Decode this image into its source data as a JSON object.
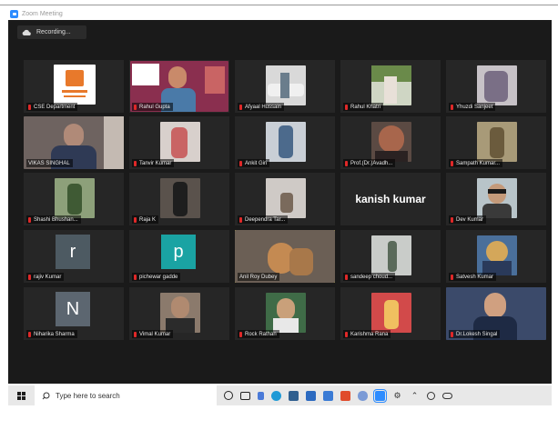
{
  "window": {
    "title": "Zoom Meeting"
  },
  "recording": {
    "label": "Recording..."
  },
  "participants": [
    {
      "name": "CSE Department",
      "bg": "#ffffff",
      "accent": "#e8792b"
    },
    {
      "name": "Rahul Gupta",
      "bg": "#8a2f4f",
      "accent": "#c98a6a"
    },
    {
      "name": "Afyaal Hussain",
      "bg": "#d9d9d9",
      "accent": "#6a7d8c"
    },
    {
      "name": "Rahul Khatri",
      "bg": "#cfd6c4",
      "accent": "#6a8a4a"
    },
    {
      "name": "Yhuzdi Sanjeet",
      "bg": "#c7c2c7",
      "accent": "#7a6f86"
    },
    {
      "name": "VIKAS SINGHAL",
      "bg": "#6e6360",
      "accent": "#3b3a40"
    },
    {
      "name": "Tanvir Kumar",
      "bg": "#d8d0cc",
      "accent": "#c96464"
    },
    {
      "name": "Ankit Giri",
      "bg": "#c9cfd6",
      "accent": "#4c6a8c"
    },
    {
      "name": "Prof.(Dr.)Avadh...",
      "bg": "#5b4a43",
      "accent": "#2a2222"
    },
    {
      "name": "Sampath Kumar...",
      "bg": "#a89a78",
      "accent": "#6b5b3d"
    },
    {
      "name": "Shashi Bhushan...",
      "bg": "#8da07a",
      "accent": "#3f5a34"
    },
    {
      "name": "Raja K",
      "bg": "#5a524c",
      "accent": "#1e1e1e"
    },
    {
      "name": "Deependra Tar...",
      "bg": "#cfcac6",
      "accent": "#7a6a5c"
    },
    {
      "name": "kanish kumar",
      "bg": "#262626",
      "accent": "#ffffff"
    },
    {
      "name": "Dev Kumar",
      "bg": "#b8c4c9",
      "accent": "#3a3a3a"
    },
    {
      "name": "rajiv Kumar",
      "bg": "#4d5a62",
      "accent": "#ffffff"
    },
    {
      "name": "pichewar gadde",
      "bg": "#1aa3a3",
      "accent": "#ffffff"
    },
    {
      "name": "Anil Roy Dubey",
      "bg": "#6b5f55",
      "accent": "#c48a52"
    },
    {
      "name": "sandeep choud...",
      "bg": "#c9ccc9",
      "accent": "#5a6a5a"
    },
    {
      "name": "Satvesh Kumar",
      "bg": "#4a6f9a",
      "accent": "#d4a75a"
    },
    {
      "name": "Niharika Sharma",
      "bg": "#5c6670",
      "accent": "#ffffff"
    },
    {
      "name": "Vimal Kumar",
      "bg": "#8b7a6c",
      "accent": "#2b2b2b"
    },
    {
      "name": "Rock Rathan",
      "bg": "#3f6b47",
      "accent": "#c9a07a"
    },
    {
      "name": "Karishma Rana",
      "bg": "#d24a4a",
      "accent": "#f0c060"
    },
    {
      "name": "Dr.Lokesh Singal",
      "bg": "#3b4a6a",
      "accent": "#d0a080"
    }
  ],
  "avatars": {
    "rajiv": "r",
    "pichewar": "p",
    "niharika": "N"
  },
  "taskbar": {
    "search_placeholder": "Type here to search"
  },
  "colors": {
    "meeting_bg": "#1a1a1a",
    "tile_bg": "#262626",
    "active_border": "#c9d23a",
    "mic_muted": "#e02828"
  }
}
